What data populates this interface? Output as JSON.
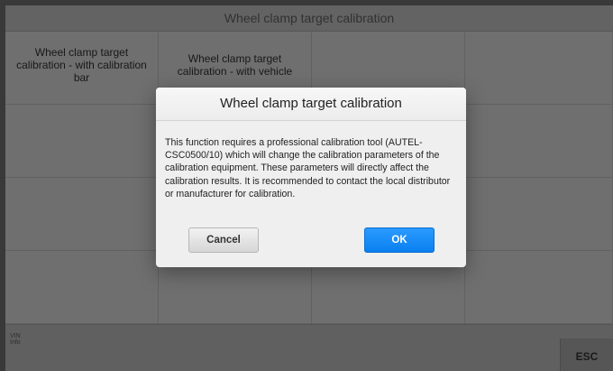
{
  "window": {
    "title": "Wheel clamp target calibration"
  },
  "grid": {
    "items": [
      {
        "label": "Wheel clamp target calibration - with calibration bar"
      },
      {
        "label": "Wheel clamp target calibration - with vehicle"
      }
    ]
  },
  "footer": {
    "vin_label": "VIN",
    "info_label": "Info",
    "esc_label": "ESC"
  },
  "dialog": {
    "title": "Wheel clamp target calibration",
    "message": "This function requires a professional calibration tool (AUTEL-CSC0500/10) which will change the calibration parameters of the calibration equipment. These parameters will directly affect the calibration results. It is recommended to contact the local distributor or manufacturer for calibration.",
    "cancel_label": "Cancel",
    "ok_label": "OK"
  },
  "colors": {
    "ok_button": "#0a7ff0",
    "dialog_background": "#efefef",
    "app_background": "#8e8e8e"
  }
}
